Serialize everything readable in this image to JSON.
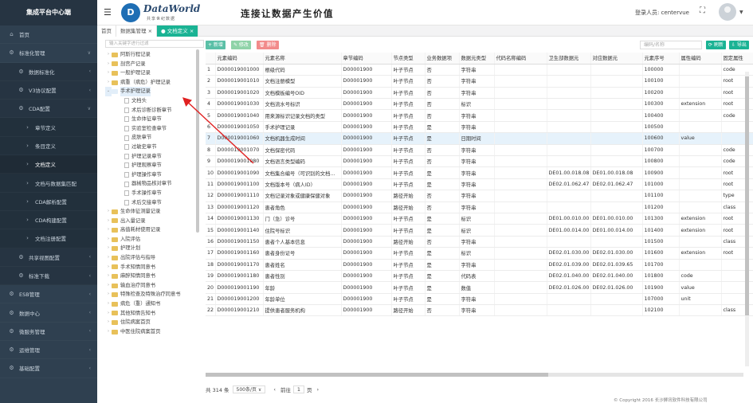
{
  "sidebar": {
    "brand": "集成平台中心端",
    "items": [
      {
        "label": "首页",
        "icon": "home-icon",
        "level": 0
      },
      {
        "label": "标准化管理",
        "icon": "gear-icon",
        "level": 0,
        "caret": "v"
      },
      {
        "label": "数据标准化",
        "icon": "gear-icon",
        "level": 1,
        "caret": "<"
      },
      {
        "label": "V3协议配置",
        "icon": "gear-icon",
        "level": 1,
        "caret": "<"
      },
      {
        "label": "CDA配置",
        "icon": "gear-icon",
        "level": 1,
        "caret": "v"
      },
      {
        "label": "章节定义",
        "icon": "arrow-icon",
        "level": 2
      },
      {
        "label": "条目定义",
        "icon": "arrow-icon",
        "level": 2
      },
      {
        "label": "文档定义",
        "icon": "arrow-icon",
        "level": 2,
        "active": true
      },
      {
        "label": "文档与数据集匹配",
        "icon": "arrow-icon",
        "level": 2
      },
      {
        "label": "CDA解析配置",
        "icon": "arrow-icon",
        "level": 2
      },
      {
        "label": "CDA构建配置",
        "icon": "arrow-icon",
        "level": 2
      },
      {
        "label": "文档注册配置",
        "icon": "arrow-icon",
        "level": 2
      },
      {
        "label": "共享视图配置",
        "icon": "gear-icon",
        "level": 1,
        "caret": "<"
      },
      {
        "label": "标准下载",
        "icon": "gear-icon",
        "level": 1,
        "caret": "<"
      },
      {
        "label": "ESB管理",
        "icon": "gear-icon",
        "level": 0,
        "caret": "<"
      },
      {
        "label": "数据中心",
        "icon": "gear-icon",
        "level": 0,
        "caret": "<"
      },
      {
        "label": "微服务管理",
        "icon": "gear-icon",
        "level": 0,
        "caret": "<"
      },
      {
        "label": "运维管理",
        "icon": "gear-icon",
        "level": 0,
        "caret": "<"
      },
      {
        "label": "基础配置",
        "icon": "gear-icon",
        "level": 0,
        "caret": "<"
      }
    ]
  },
  "header": {
    "logo_letter": "D",
    "brand_name": "DataWorld",
    "brand_sub": "共享世纪数据",
    "slogan": "连接让数据产生价值",
    "user_label": "登录人员: centervue"
  },
  "tabs": [
    {
      "label": "首页",
      "on": false
    },
    {
      "label": "数据集管理 ×",
      "on": false
    },
    {
      "label": "● 文档定义 ×",
      "on": true
    }
  ],
  "tree": {
    "search_placeholder": "输入关键字进行过滤",
    "nodes": [
      {
        "label": "阿斯行程记录",
        "lvl": 1,
        "type": "folder"
      },
      {
        "label": "剖宫产记录",
        "lvl": 1,
        "type": "folder"
      },
      {
        "label": "一般护理记录",
        "lvl": 1,
        "type": "folder"
      },
      {
        "label": "病重（病危）护理记录",
        "lvl": 1,
        "type": "folder"
      },
      {
        "label": "手术护理记录",
        "lvl": 1,
        "type": "folder",
        "open": true,
        "hl": true
      },
      {
        "label": "文档头",
        "lvl": 2,
        "type": "file"
      },
      {
        "label": "术后诊断诊断章节",
        "lvl": 2,
        "type": "file"
      },
      {
        "label": "生命体征章节",
        "lvl": 2,
        "type": "file"
      },
      {
        "label": "实验室检查章节",
        "lvl": 2,
        "type": "file"
      },
      {
        "label": "皮肤章节",
        "lvl": 2,
        "type": "file"
      },
      {
        "label": "过敏史章节",
        "lvl": 2,
        "type": "file"
      },
      {
        "label": "护理记录章节",
        "lvl": 2,
        "type": "file"
      },
      {
        "label": "护理观察章节",
        "lvl": 2,
        "type": "file"
      },
      {
        "label": "护理操作章节",
        "lvl": 2,
        "type": "file"
      },
      {
        "label": "器械物品核对章节",
        "lvl": 2,
        "type": "file"
      },
      {
        "label": "手术操作章节",
        "lvl": 2,
        "type": "file"
      },
      {
        "label": "术后交接章节",
        "lvl": 2,
        "type": "file"
      },
      {
        "label": "生命体征测量记录",
        "lvl": 1,
        "type": "folder"
      },
      {
        "label": "出入量记录",
        "lvl": 1,
        "type": "folder"
      },
      {
        "label": "高值耗材使用记录",
        "lvl": 1,
        "type": "folder"
      },
      {
        "label": "入院评估",
        "lvl": 1,
        "type": "folder"
      },
      {
        "label": "护理计划",
        "lvl": 1,
        "type": "folder"
      },
      {
        "label": "出院评估与指导",
        "lvl": 1,
        "type": "folder"
      },
      {
        "label": "手术知情同意书",
        "lvl": 1,
        "type": "folder"
      },
      {
        "label": "麻醉知情同意书",
        "lvl": 1,
        "type": "folder"
      },
      {
        "label": "输血治疗同意书",
        "lvl": 1,
        "type": "folder"
      },
      {
        "label": "特殊检查及特殊治疗同意书",
        "lvl": 1,
        "type": "folder"
      },
      {
        "label": "病危（重）通知书",
        "lvl": 1,
        "type": "folder"
      },
      {
        "label": "其他知情告知书",
        "lvl": 1,
        "type": "folder"
      },
      {
        "label": "住院病案首页",
        "lvl": 1,
        "type": "folder"
      },
      {
        "label": "中医住院病案首页",
        "lvl": 1,
        "type": "folder"
      }
    ]
  },
  "toolbar": {
    "add": "+ 新增",
    "edit": "✎ 修改",
    "del": "🗑 删除",
    "search_placeholder": "编码/名称",
    "refresh": "⟳ 刷新",
    "export": "⇩ 导出"
  },
  "colors": {
    "sidebar": "#2f4050",
    "accent": "#1ab394",
    "add": "#5bc0a7",
    "edit": "#8fd3a8",
    "del": "#f28b8b"
  },
  "table": {
    "headers": [
      "",
      "元素编码",
      "元素名称",
      "章节编码",
      "节点类型",
      "业务数据项",
      "数据元类型",
      "代码名称编码",
      "卫生部数据元",
      "对应数据元",
      "元素序号",
      "属性编码",
      "固定属性"
    ],
    "rows": [
      [
        "1",
        "D000019001000",
        "根级代码",
        "D00001900",
        "叶子节点",
        "否",
        "字符串",
        "",
        "",
        "",
        "100000",
        "",
        "code"
      ],
      [
        "2",
        "D000019001010",
        "文档注册模型",
        "D00001900",
        "叶子节点",
        "否",
        "字符串",
        "",
        "",
        "",
        "100100",
        "",
        "root"
      ],
      [
        "3",
        "D000019001020",
        "文档模板编号OID",
        "D00001900",
        "叶子节点",
        "否",
        "字符串",
        "",
        "",
        "",
        "100200",
        "",
        "root"
      ],
      [
        "4",
        "D000019001030",
        "文档流水号标识",
        "D00001900",
        "叶子节点",
        "否",
        "标识",
        "",
        "",
        "",
        "100300",
        "extension",
        "root"
      ],
      [
        "5",
        "D000019001040",
        "用来源标识记录文档的类型",
        "D00001900",
        "叶子节点",
        "否",
        "字符串",
        "",
        "",
        "",
        "100400",
        "",
        "code"
      ],
      [
        "6",
        "D000019001050",
        "手术护理记录",
        "D00001900",
        "叶子节点",
        "是",
        "字符串",
        "",
        "",
        "",
        "100500",
        "",
        ""
      ],
      [
        "7",
        "D000019001060",
        "文档机器生成时间",
        "D00001900",
        "叶子节点",
        "是",
        "日期时间",
        "",
        "",
        "",
        "100600",
        "value",
        ""
      ],
      [
        "8",
        "D000019001070",
        "文档保密代码",
        "D00001900",
        "叶子节点",
        "否",
        "字符串",
        "",
        "",
        "",
        "100700",
        "",
        "code"
      ],
      [
        "9",
        "D000019001080",
        "文档语言类型编码",
        "D00001900",
        "叶子节点",
        "否",
        "字符串",
        "",
        "",
        "",
        "100800",
        "",
        "code"
      ],
      [
        "10",
        "D000019001090",
        "文档集合编号（可识别的文档...",
        "D00001900",
        "叶子节点",
        "是",
        "字符串",
        "",
        "DE01.00.018.08",
        "DE01.00.018.08",
        "100900",
        "",
        "root"
      ],
      [
        "11",
        "D000019001100",
        "文档版本号（病人ID）",
        "D00001900",
        "叶子节点",
        "是",
        "字符串",
        "",
        "DE02.01.062.47",
        "DE02.01.062.47",
        "101000",
        "",
        "root"
      ],
      [
        "12",
        "D000019001110",
        "文档记录对象或健康保健对象",
        "D00001900",
        "路径开始",
        "否",
        "字符串",
        "",
        "",
        "",
        "101100",
        "",
        "type"
      ],
      [
        "13",
        "D000019001120",
        "患者角色",
        "D00001900",
        "路径开始",
        "否",
        "字符串",
        "",
        "",
        "",
        "101200",
        "",
        "class"
      ],
      [
        "14",
        "D000019001130",
        "门（急）诊号",
        "D00001900",
        "叶子节点",
        "是",
        "标识",
        "",
        "DE01.00.010.00",
        "DE01.00.010.00",
        "101300",
        "extension",
        "root"
      ],
      [
        "15",
        "D000019001140",
        "住院号标识",
        "D00001900",
        "叶子节点",
        "是",
        "标识",
        "",
        "DE01.00.014.00",
        "DE01.00.014.00",
        "101400",
        "extension",
        "root"
      ],
      [
        "16",
        "D000019001150",
        "患者个人基本信息",
        "D00001900",
        "路径开始",
        "否",
        "字符串",
        "",
        "",
        "",
        "101500",
        "",
        "class"
      ],
      [
        "17",
        "D000019001160",
        "患者身份证号",
        "D00001900",
        "叶子节点",
        "是",
        "标识",
        "",
        "DE02.01.030.00",
        "DE02.01.030.00",
        "101600",
        "extension",
        "root"
      ],
      [
        "18",
        "D000019001170",
        "患者姓名",
        "D00001900",
        "叶子节点",
        "是",
        "字符串",
        "",
        "DE02.01.039.00",
        "DE02.01.039.65",
        "101700",
        "",
        ""
      ],
      [
        "19",
        "D000019001180",
        "患者性别",
        "D00001900",
        "叶子节点",
        "是",
        "代码表",
        "",
        "DE02.01.040.00",
        "DE02.01.040.00",
        "101800",
        "code",
        ""
      ],
      [
        "20",
        "D000019001190",
        "年龄",
        "D00001900",
        "叶子节点",
        "是",
        "数值",
        "",
        "DE02.01.026.00",
        "DE02.01.026.00",
        "101900",
        "value",
        ""
      ],
      [
        "21",
        "D000019001200",
        "年龄单位",
        "D00001900",
        "叶子节点",
        "是",
        "字符串",
        "",
        "",
        "",
        "107000",
        "unit",
        ""
      ],
      [
        "22",
        "D000019001210",
        "提供患者服务机构",
        "D00001900",
        "路径开始",
        "否",
        "字符串",
        "",
        "",
        "",
        "102100",
        "",
        "class"
      ]
    ]
  },
  "pager": {
    "total": "共 314 条",
    "size": "500条/页 ∨",
    "prev": "‹",
    "goto": "前往",
    "page": "1",
    "page_unit": "页",
    "next": "›"
  },
  "footer": "© Copyright 2016 长沙狮讯软件科技有限公司"
}
